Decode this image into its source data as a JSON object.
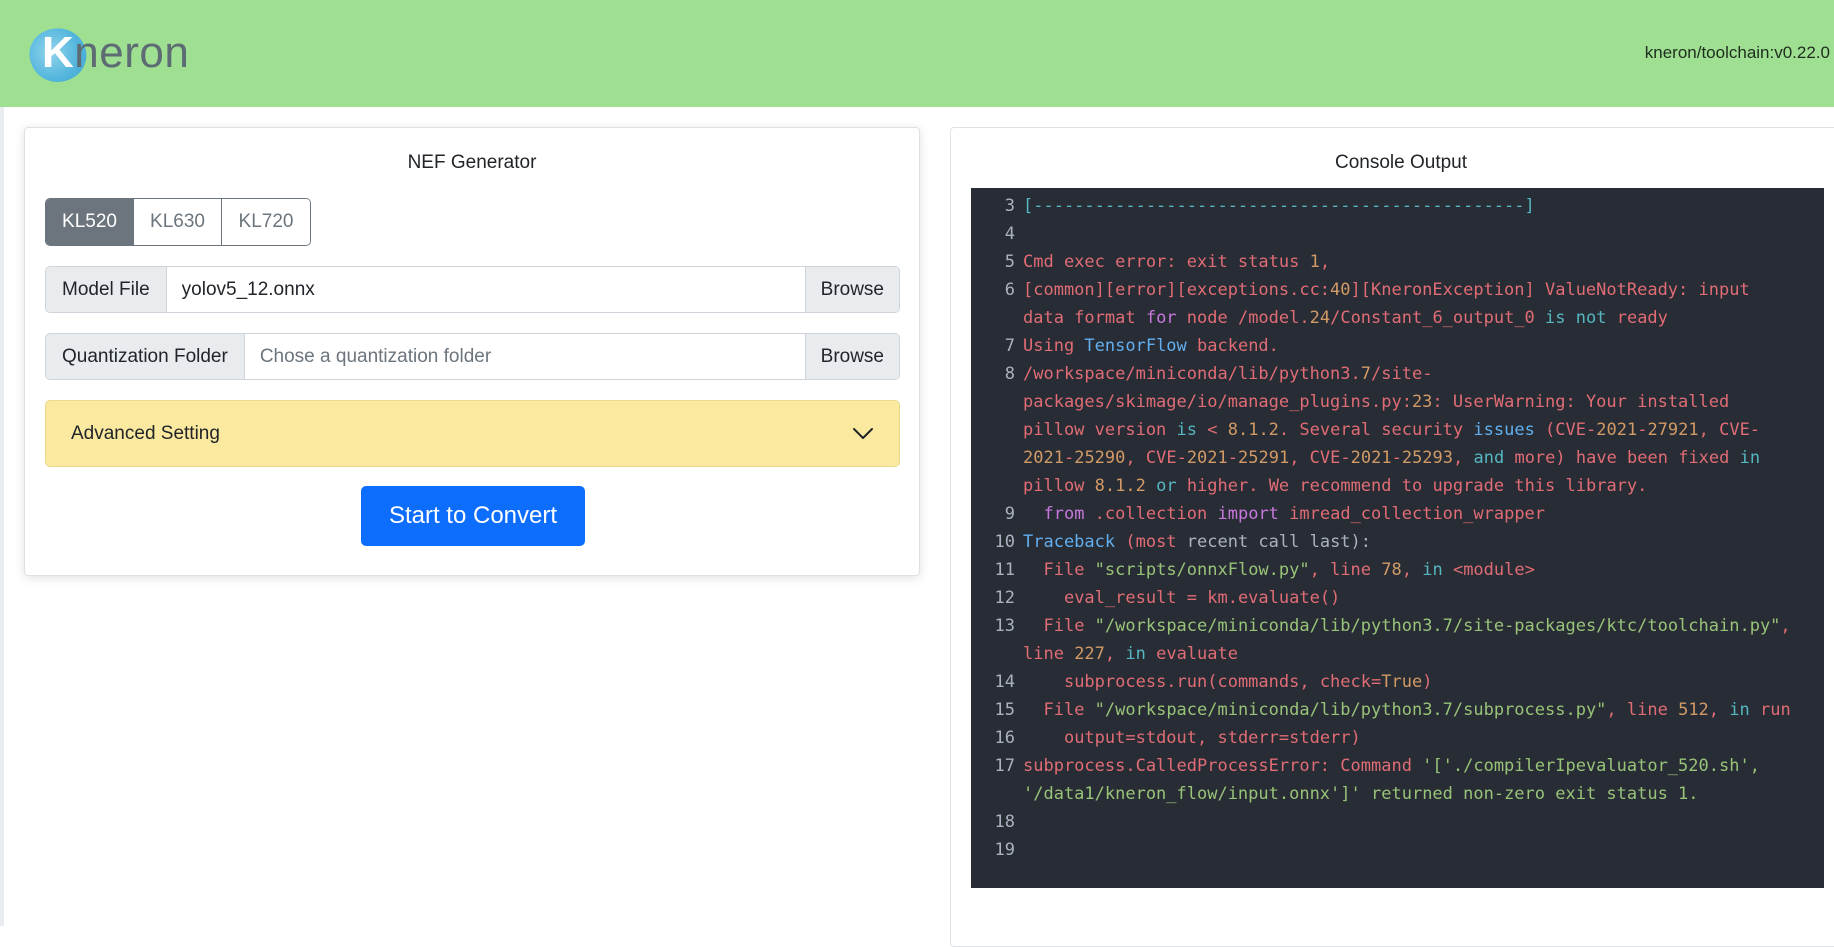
{
  "header": {
    "logo_text_k": "K",
    "logo_text_rest": "neron",
    "version": "kneron/toolchain:v0.22.0",
    "bg_color": "#9fdf92"
  },
  "nef_generator": {
    "title": "NEF Generator",
    "chips": [
      {
        "label": "KL520",
        "active": true
      },
      {
        "label": "KL630",
        "active": false
      },
      {
        "label": "KL720",
        "active": false
      }
    ],
    "model_file": {
      "label": "Model File",
      "value": "yolov5_12.onnx",
      "browse_label": "Browse"
    },
    "quant_folder": {
      "label": "Quantization Folder",
      "placeholder": "Chose a quantization folder",
      "value": "",
      "browse_label": "Browse"
    },
    "advanced": {
      "label": "Advanced Setting",
      "expanded": false
    },
    "convert_label": "Start to Convert"
  },
  "console": {
    "title": "Console Output",
    "lines": [
      {
        "n": "3",
        "segs": [
          [
            "t-cyan",
            "[------------------------------------------------]"
          ]
        ]
      },
      {
        "n": "4",
        "segs": []
      },
      {
        "n": "5",
        "segs": [
          [
            "t-red",
            "Cmd exec error: exit status "
          ],
          [
            "t-orange",
            "1"
          ],
          [
            "t-red",
            ","
          ]
        ]
      },
      {
        "n": "6",
        "segs": [
          [
            "t-red",
            "[common][error][exceptions.cc:"
          ],
          [
            "t-orange",
            "40"
          ],
          [
            "t-red",
            "][KneronException] ValueNotReady: input data format "
          ],
          [
            "t-purple",
            "for"
          ],
          [
            "t-red",
            " node /model."
          ],
          [
            "t-orange",
            "24"
          ],
          [
            "t-red",
            "/Constant_6_output_0 "
          ],
          [
            "t-cyan",
            "is"
          ],
          [
            "t-red",
            " "
          ],
          [
            "t-cyan",
            "not"
          ],
          [
            "t-red",
            " ready"
          ]
        ]
      },
      {
        "n": "7",
        "segs": [
          [
            "t-red",
            "Using "
          ],
          [
            "t-blue",
            "TensorFlow"
          ],
          [
            "t-red",
            " backend."
          ]
        ]
      },
      {
        "n": "8",
        "segs": [
          [
            "t-red",
            "/workspace/miniconda/lib/python3."
          ],
          [
            "t-orange",
            "7"
          ],
          [
            "t-red",
            "/site-packages/skimage/io/manage_plugins.py:"
          ],
          [
            "t-orange",
            "23"
          ],
          [
            "t-red",
            ": UserWarning: Your installed pillow version "
          ],
          [
            "t-cyan",
            "is"
          ],
          [
            "t-red",
            " < "
          ],
          [
            "t-orange",
            "8.1.2"
          ],
          [
            "t-red",
            ". Several security "
          ],
          [
            "t-blue",
            "issues"
          ],
          [
            "t-red",
            " (CVE-"
          ],
          [
            "t-orange",
            "2021"
          ],
          [
            "t-red",
            "-"
          ],
          [
            "t-orange",
            "27921"
          ],
          [
            "t-red",
            ", CVE-"
          ],
          [
            "t-orange",
            "2021"
          ],
          [
            "t-red",
            "-"
          ],
          [
            "t-orange",
            "25290"
          ],
          [
            "t-red",
            ", CVE-"
          ],
          [
            "t-orange",
            "2021"
          ],
          [
            "t-red",
            "-"
          ],
          [
            "t-orange",
            "25291"
          ],
          [
            "t-red",
            ", CVE-"
          ],
          [
            "t-orange",
            "2021"
          ],
          [
            "t-red",
            "-"
          ],
          [
            "t-orange",
            "25293"
          ],
          [
            "t-red",
            ", "
          ],
          [
            "t-cyan",
            "and"
          ],
          [
            "t-red",
            " more) have been fixed "
          ],
          [
            "t-cyan",
            "in"
          ],
          [
            "t-red",
            " pillow "
          ],
          [
            "t-orange",
            "8.1.2"
          ],
          [
            "t-red",
            " "
          ],
          [
            "t-cyan",
            "or"
          ],
          [
            "t-red",
            " higher. We recommend to upgrade this library."
          ]
        ]
      },
      {
        "n": "9",
        "segs": [
          [
            "t-red",
            "  "
          ],
          [
            "t-purple",
            "from"
          ],
          [
            "t-red",
            " .collection "
          ],
          [
            "t-purple",
            "import"
          ],
          [
            "t-red",
            " imread_collection_wrapper"
          ]
        ]
      },
      {
        "n": "10",
        "segs": [
          [
            "t-blue",
            "Traceback"
          ],
          [
            "t-red",
            " (most "
          ],
          [
            "t-grey",
            "recent call last):"
          ]
        ]
      },
      {
        "n": "11",
        "segs": [
          [
            "t-red",
            "  File "
          ],
          [
            "t-green",
            "\"scripts/onnxFlow.py\""
          ],
          [
            "t-red",
            ", line "
          ],
          [
            "t-orange",
            "78"
          ],
          [
            "t-red",
            ", "
          ],
          [
            "t-cyan",
            "in"
          ],
          [
            "t-red",
            " <module>"
          ]
        ]
      },
      {
        "n": "12",
        "segs": [
          [
            "t-red",
            "    eval_result = km.evaluate()"
          ]
        ]
      },
      {
        "n": "13",
        "segs": [
          [
            "t-red",
            "  File "
          ],
          [
            "t-green",
            "\"/workspace/miniconda/lib/python3.7/site-packages/ktc/toolchain.py\""
          ],
          [
            "t-red",
            ", line "
          ],
          [
            "t-orange",
            "227"
          ],
          [
            "t-red",
            ", "
          ],
          [
            "t-cyan",
            "in"
          ],
          [
            "t-red",
            " evaluate"
          ]
        ]
      },
      {
        "n": "14",
        "segs": [
          [
            "t-red",
            "    subprocess.run(commands, check="
          ],
          [
            "t-orange",
            "True"
          ],
          [
            "t-red",
            ")"
          ]
        ]
      },
      {
        "n": "15",
        "segs": [
          [
            "t-red",
            "  File "
          ],
          [
            "t-green",
            "\"/workspace/miniconda/lib/python3.7/subprocess.py\""
          ],
          [
            "t-red",
            ", line "
          ],
          [
            "t-orange",
            "512"
          ],
          [
            "t-red",
            ", "
          ],
          [
            "t-cyan",
            "in"
          ],
          [
            "t-red",
            " run"
          ]
        ]
      },
      {
        "n": "16",
        "segs": [
          [
            "t-red",
            "    output=stdout, stderr=stderr)"
          ]
        ]
      },
      {
        "n": "17",
        "segs": [
          [
            "t-red",
            "subprocess.CalledProcessError: Command "
          ],
          [
            "t-green",
            "'['./compilerIpevaluator_520.sh', '/data1/kneron_flow/input.onnx']'"
          ],
          [
            "t-red",
            " "
          ],
          [
            "t-green",
            "returned non-zero exit status 1."
          ]
        ]
      },
      {
        "n": "18",
        "segs": []
      },
      {
        "n": "19",
        "segs": []
      }
    ]
  }
}
